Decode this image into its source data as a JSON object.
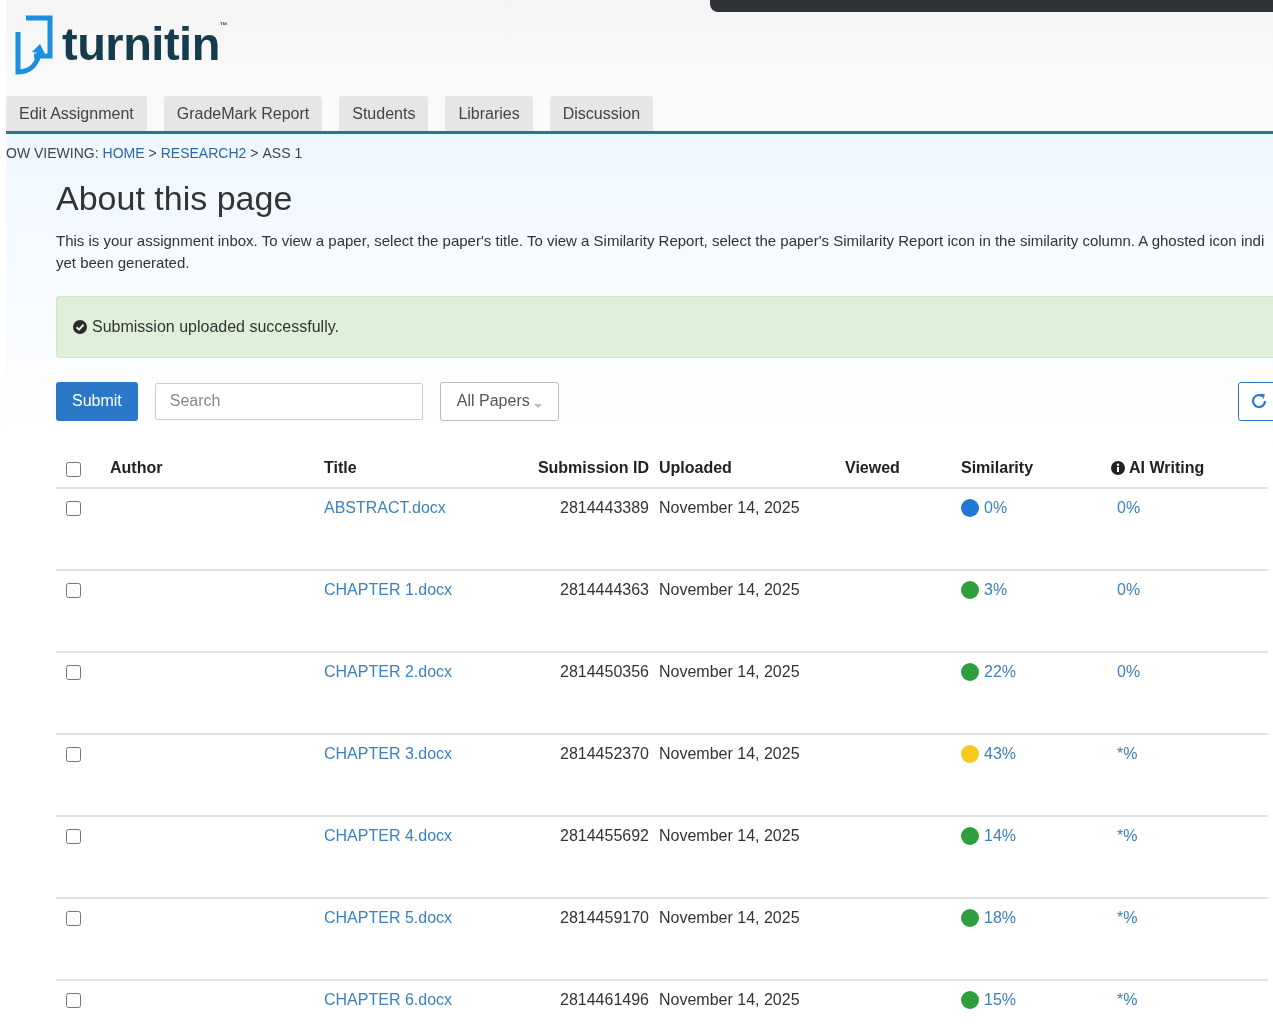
{
  "logo": {
    "text": "turnitin",
    "mark": "™"
  },
  "tabs": [
    {
      "label": "Edit Assignment",
      "selected": false
    },
    {
      "label": "GradeMark Report",
      "selected": false
    },
    {
      "label": "Students",
      "selected": false
    },
    {
      "label": "Libraries",
      "selected": false
    },
    {
      "label": "Discussion",
      "selected": false
    }
  ],
  "breadcrumb": {
    "prefix": "OW VIEWING:",
    "links": [
      "HOME",
      "RESEARCH2"
    ],
    "current": "ASS 1",
    "separator": ">"
  },
  "heading": "About this page",
  "description": "This is your assignment inbox. To view a paper, select the paper's title. To view a Similarity Report, select the paper's Similarity Report icon in the similarity column. A ghosted icon indi\nyet been generated.",
  "alert": "Submission uploaded successfully.",
  "toolbar": {
    "submit": "Submit",
    "search_placeholder": "Search",
    "filter": "All Papers"
  },
  "table": {
    "columns": [
      "Author",
      "Title",
      "Submission ID",
      "Uploaded",
      "Viewed",
      "Similarity",
      "AI Writing"
    ],
    "select_all_checked": false,
    "rows": [
      {
        "checked": false,
        "title": "ABSTRACT.docx",
        "submission_id": "2814443389",
        "uploaded": "November 14, 2025",
        "similarity": "0%",
        "color": "#1e78d4",
        "ai_writing": "0%"
      },
      {
        "checked": false,
        "title": "CHAPTER 1.docx",
        "submission_id": "2814444363",
        "uploaded": "November 14, 2025",
        "similarity": "3%",
        "color": "#2e9e3e",
        "ai_writing": "0%"
      },
      {
        "checked": false,
        "title": "CHAPTER 2.docx",
        "submission_id": "2814450356",
        "uploaded": "November 14, 2025",
        "similarity": "22%",
        "color": "#2e9e3e",
        "ai_writing": "0%"
      },
      {
        "checked": false,
        "title": "CHAPTER 3.docx",
        "submission_id": "2814452370",
        "uploaded": "November 14, 2025",
        "similarity": "43%",
        "color": "#f7c81e",
        "ai_writing": "*%"
      },
      {
        "checked": false,
        "title": "CHAPTER 4.docx",
        "submission_id": "2814455692",
        "uploaded": "November 14, 2025",
        "similarity": "14%",
        "color": "#2e9e3e",
        "ai_writing": "*%"
      },
      {
        "checked": false,
        "title": "CHAPTER 5.docx",
        "submission_id": "2814459170",
        "uploaded": "November 14, 2025",
        "similarity": "18%",
        "color": "#2e9e3e",
        "ai_writing": "*%"
      },
      {
        "checked": false,
        "title": "CHAPTER 6.docx",
        "submission_id": "2814461496",
        "uploaded": "November 14, 2025",
        "similarity": "15%",
        "color": "#2e9e3e",
        "ai_writing": "*%"
      }
    ]
  }
}
